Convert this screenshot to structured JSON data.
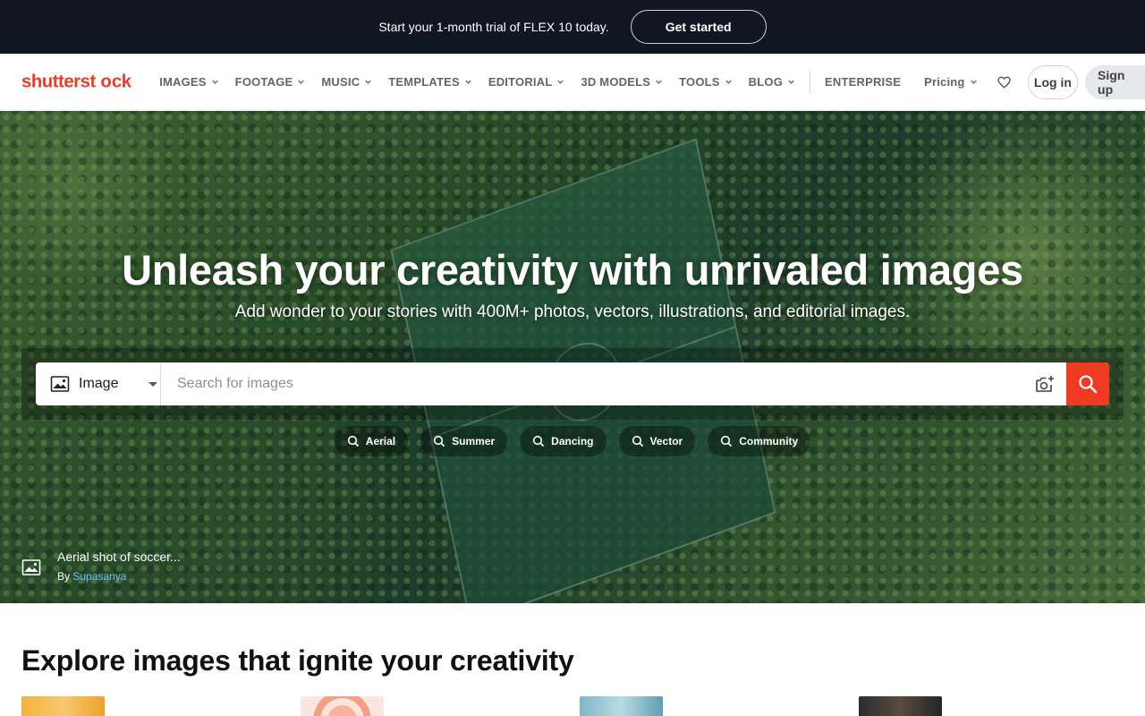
{
  "promo": {
    "text": "Start your 1-month trial of FLEX 10 today.",
    "cta": "Get started"
  },
  "nav": {
    "logo": "shutterstock",
    "items": [
      {
        "label": "IMAGES"
      },
      {
        "label": "FOOTAGE"
      },
      {
        "label": "MUSIC"
      },
      {
        "label": "TEMPLATES"
      },
      {
        "label": "EDITORIAL"
      },
      {
        "label": "3D MODELS"
      },
      {
        "label": "TOOLS"
      },
      {
        "label": "BLOG"
      }
    ],
    "enterprise": "ENTERPRISE",
    "pricing": "Pricing",
    "login": "Log in",
    "signup": "Sign up"
  },
  "hero": {
    "title": "Unleash your creativity with unrivaled images",
    "subtitle": "Add wonder to your stories with 400M+ photos, vectors, illustrations, and editorial images.",
    "search": {
      "type_label": "Image",
      "placeholder": "Search for images"
    },
    "chips": [
      "Aerial",
      "Summer",
      "Dancing",
      "Vector",
      "Community"
    ],
    "credit": {
      "title": "Aerial shot of soccer...",
      "by": "By",
      "author": "Supasanya"
    }
  },
  "explore": {
    "title": "Explore images that ignite your creativity"
  },
  "colors": {
    "promo_bg": "#101722",
    "accent_red": "#f03b24",
    "link_blue": "#6fc0ff"
  }
}
